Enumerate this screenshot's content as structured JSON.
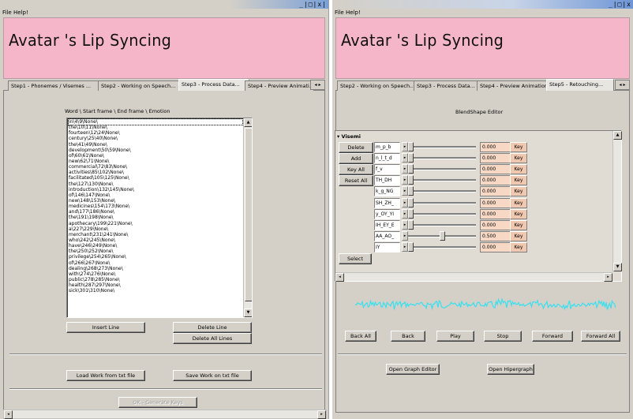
{
  "left": {
    "window_buttons": "_|□|x|",
    "menu": [
      "File",
      "Help!"
    ],
    "banner_title": "Avatar 's Lip Syncing",
    "tabs": [
      "Step1 - Phonemes / Visemes ...",
      "Step2 - Working on Speech...",
      "Step3 - Process Data...",
      "Step4 - Preview Animati..."
    ],
    "active_tab": "Step3 - Process Data...",
    "list_header": "Word \\ Start frame \\ End frame \\ Emotion",
    "list_items": [
      "in\\4\\9\\None\\",
      "the\\10\\11\\None\\",
      "fourteen\\12\\24\\None\\",
      "century\\25\\40\\None\\",
      "the\\41\\49\\None\\",
      "development\\50\\59\\None\\",
      "of\\60\\61\\None\\",
      "new\\62\\71\\None\\",
      "commercial\\72\\83\\None\\",
      "activities\\85\\102\\None\\",
      "facilitated\\105\\125\\None\\",
      "the\\127\\130\\None\\",
      "introduction\\132\\145\\None\\",
      "of\\146\\147\\None\\",
      "new\\148\\153\\None\\",
      "medicines\\154\\173\\None\\",
      "and\\177\\186\\None\\",
      "the\\191\\198\\None\\",
      "apothecary\\199\\221\\None\\",
      "a\\227\\229\\None\\",
      "merchant\\231\\241\\None\\",
      "who\\242\\245\\None\\",
      "have\\246\\249\\None\\",
      "the\\250\\252\\None\\",
      "privilege\\254\\265\\None\\",
      "of\\266\\267\\None\\",
      "dealing\\268\\273\\None\\",
      "with\\274\\276\\None\\",
      "public\\278\\285\\None\\",
      "health\\287\\297\\None\\",
      "sick\\301\\310\\None\\"
    ],
    "buttons": {
      "insert_line": "Insert Line",
      "delete_line": "Delete Line",
      "delete_all_lines": "Delete All Lines",
      "load_work": "Load Work from txt file",
      "save_work": "Save Work on txt file",
      "ok_generate": "OK - Generate Keys"
    }
  },
  "right": {
    "window_buttons": "_|□|x",
    "menu": [
      "File",
      "Help!"
    ],
    "banner_title": "Avatar 's Lip Syncing",
    "tabs": [
      "Step2 - Working on Speech...",
      "Step3 - Process Data...",
      "Step4 - Preview Animation...",
      "Step5 - Retouching..."
    ],
    "active_tab": "Step5 - Retouching...",
    "editor_title": "BlendShape Editor",
    "viseme_group": "Visemi",
    "side_buttons": [
      "Delete",
      "Add",
      "Key All",
      "Reset All"
    ],
    "select_button": "Select",
    "blendshapes": [
      {
        "name": "m_p_b",
        "value": "0.000",
        "level": 0.0
      },
      {
        "name": "n_l_t_d",
        "value": "0.000",
        "level": 0.0
      },
      {
        "name": "f_v",
        "value": "0.000",
        "level": 0.0
      },
      {
        "name": "TH_DH",
        "value": "0.000",
        "level": 0.0
      },
      {
        "name": "k_g_NG",
        "value": "0.000",
        "level": 0.0
      },
      {
        "name": "SH_ZH_",
        "value": "0.000",
        "level": 0.0
      },
      {
        "name": "y_OY_YI",
        "value": "0.000",
        "level": 0.0
      },
      {
        "name": "IH_EY_E",
        "value": "0.000",
        "level": 0.0
      },
      {
        "name": "AA_AO_",
        "value": "0.500",
        "level": 0.5
      },
      {
        "name": "IY",
        "value": "0.000",
        "level": 0.0
      }
    ],
    "key_label": "Key",
    "playback_buttons": [
      "Back All",
      "Back",
      "Play",
      "Stop",
      "Forward",
      "Forward All"
    ],
    "graph_editor": "Open Graph Editor",
    "hypergraph": "Open Hipergraph",
    "waveform_color": "#38e0f0"
  }
}
